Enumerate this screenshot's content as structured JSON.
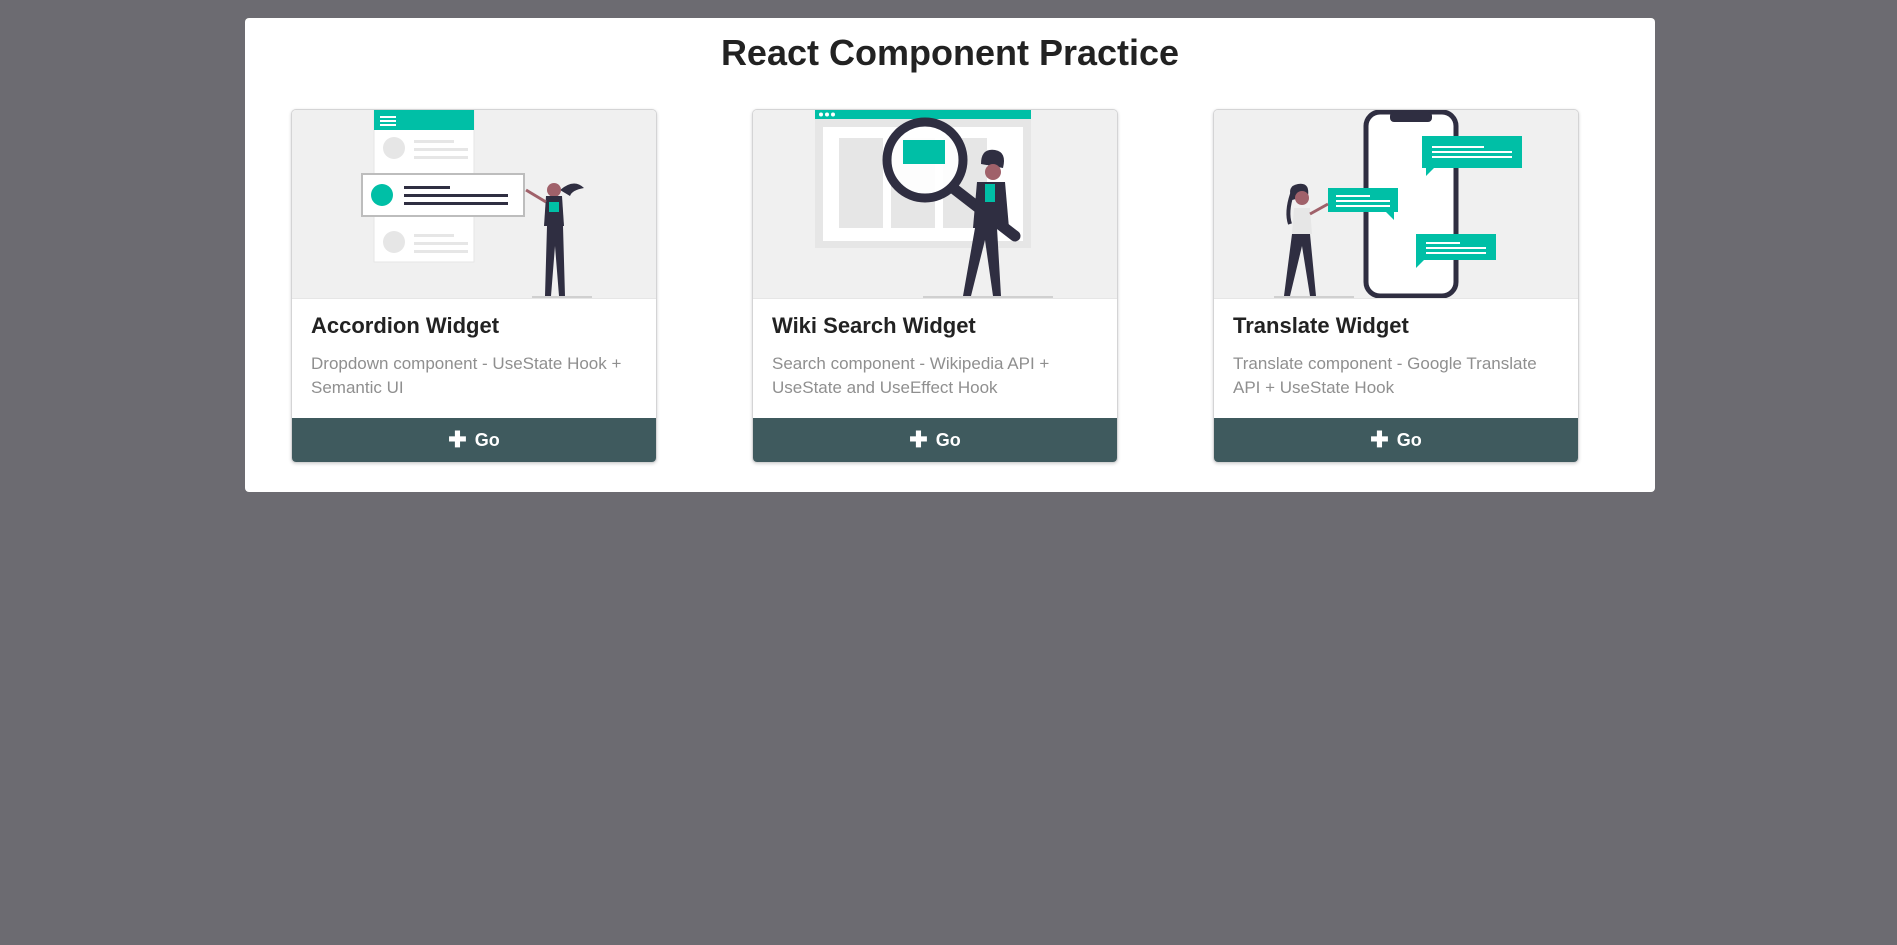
{
  "page": {
    "title": "React Component Practice"
  },
  "colors": {
    "accent": "#00bfa6",
    "button": "#3f5a5e",
    "background": "#6c6b71",
    "dark_figure": "#2f2e41"
  },
  "cards": [
    {
      "illustration": "accordion-illustration",
      "header": "Accordion Widget",
      "description": "Dropdown component - UseState Hook + Semantic UI",
      "button_icon": "plus-icon",
      "button_icon_glyph": "✚",
      "button_label": "Go"
    },
    {
      "illustration": "wiki-search-illustration",
      "header": "Wiki Search Widget",
      "description": "Search component - Wikipedia API + UseState and UseEffect Hook",
      "button_icon": "plus-icon",
      "button_icon_glyph": "✚",
      "button_label": "Go"
    },
    {
      "illustration": "translate-illustration",
      "header": "Translate Widget",
      "description": "Translate component - Google Translate API + UseState Hook",
      "button_icon": "plus-icon",
      "button_icon_glyph": "✚",
      "button_label": "Go"
    }
  ]
}
